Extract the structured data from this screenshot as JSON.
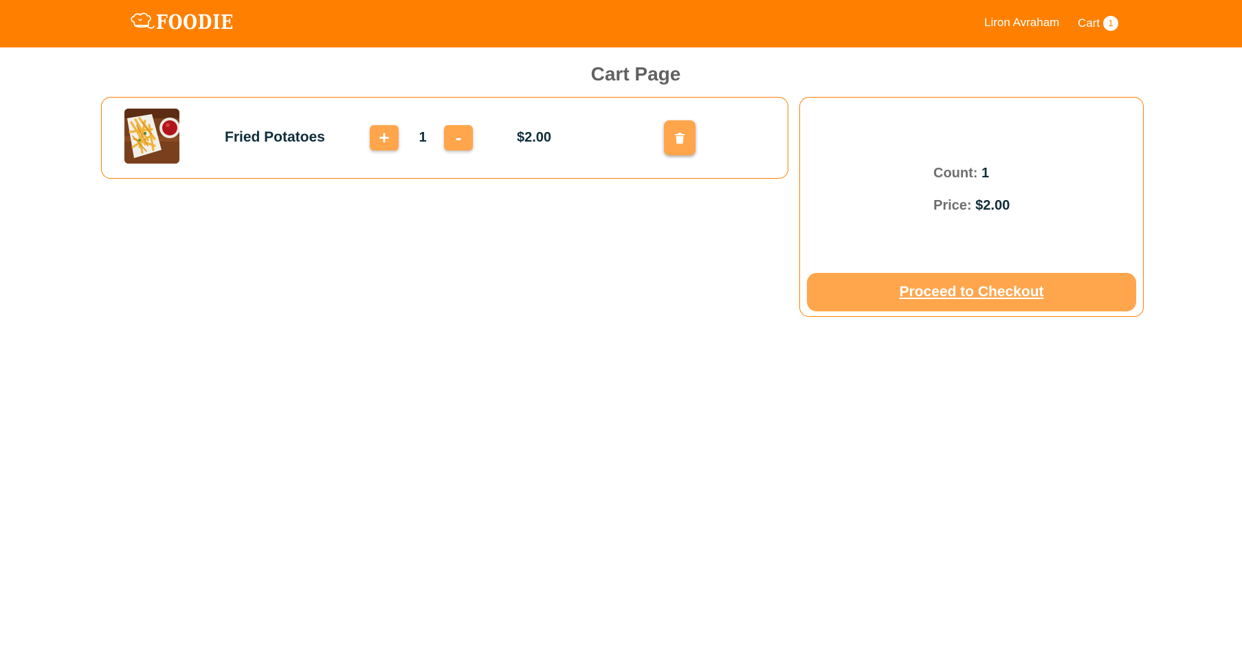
{
  "header": {
    "brand": "FOODIE",
    "user_name": "Liron Avraham",
    "cart_label": "Cart",
    "cart_count": "1",
    "background_color": "#ff8000"
  },
  "page": {
    "title": "Cart Page"
  },
  "cart": {
    "items": [
      {
        "name": "Fried Potatoes",
        "image_icon": "fried-potatoes-photo",
        "increment_label": "+",
        "quantity": "1",
        "decrement_label": "-",
        "price": "$2.00",
        "delete_icon": "trash-icon"
      }
    ]
  },
  "summary": {
    "count_label": "Count:",
    "count_value": "1",
    "price_label": "Price:",
    "price_value": "$2.00",
    "checkout_label": "Proceed to Checkout"
  },
  "colors": {
    "accent": "#ff8000",
    "button": "#ffa64d",
    "text_dark": "#0f2d3a",
    "text_muted": "#6e6e6e"
  }
}
